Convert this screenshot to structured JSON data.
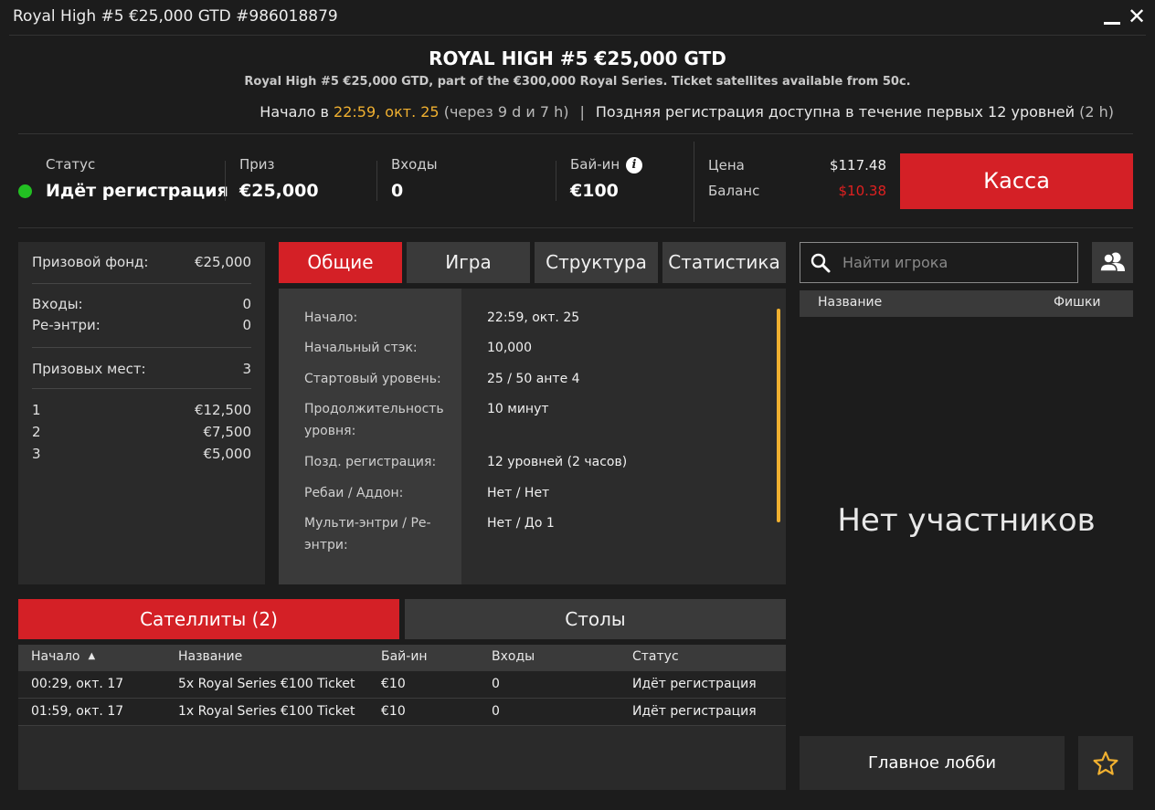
{
  "window": {
    "title": "Royal High #5 €25,000 GTD #986018879",
    "minimize_label": "_",
    "close_label": "✕"
  },
  "header": {
    "title": "ROYAL HIGH #5 €25,000 GTD",
    "subtitle": "Royal High #5 €25,000 GTD, part of the €300,000 Royal Series. Ticket satellites available from 50c.",
    "start_prefix": "Начало в ",
    "start_time": "22:59, окт. 25",
    "start_relative": " (через 9 d и 7 h)",
    "divider": "|",
    "late_reg": "Поздняя регистрация доступна в течение первых 12 уровней",
    "late_reg_duration": " (2 h)"
  },
  "stats": {
    "status_label": "Статус",
    "status_value": "Идёт регистрация",
    "status_color": "#22c022",
    "prize_label": "Приз",
    "prize_value": "€25,000",
    "entries_label": "Входы",
    "entries_value": "0",
    "buyin_label": "Бай-ин",
    "buyin_value": "€100",
    "info_icon": "i",
    "price_label": "Цена",
    "price_value": "$117.48",
    "balance_label": "Баланс",
    "balance_value": "$10.38",
    "balance_color": "#e02020",
    "cashier_label": "Касса"
  },
  "prize_panel": {
    "prize_pool_label": "Призовой фонд:",
    "prize_pool_value": "€25,000",
    "entries_label": "Входы:",
    "entries_value": "0",
    "reentries_label": "Ре-энтри:",
    "reentries_value": "0",
    "places_label": "Призовых мест:",
    "places_value": "3",
    "payouts": [
      {
        "place": "1",
        "amount": "€12,500"
      },
      {
        "place": "2",
        "amount": "€7,500"
      },
      {
        "place": "3",
        "amount": "€5,000"
      }
    ]
  },
  "tabs": [
    "Общие",
    "Игра",
    "Структура",
    "Статистика"
  ],
  "info": [
    {
      "label": "Начало:",
      "value": "22:59, окт. 25"
    },
    {
      "label": "Начальный стэк:",
      "value": "10,000"
    },
    {
      "label": "Стартовый уровень:",
      "value": "25 / 50 анте 4"
    },
    {
      "label": "Продолжительность уровня:",
      "value": "10 минут"
    },
    {
      "label": "Позд. регистрация:",
      "value": "12 уровней (2 часов)"
    },
    {
      "label": "Ребаи / Аддон:",
      "value": "Нет / Нет"
    },
    {
      "label": "Мульти-энтри / Ре-энтри:",
      "value": "Нет / До 1"
    }
  ],
  "bottom_tabs": [
    "Сателлиты (2)",
    "Столы"
  ],
  "satellites": {
    "columns": [
      "Начало",
      "Название",
      "Бай-ин",
      "Входы",
      "Статус"
    ],
    "sort_icon": "▲",
    "rows": [
      [
        "00:29, окт. 17",
        "5x Royal Series €100 Ticket",
        "€10",
        "0",
        "Идёт регистрация"
      ],
      [
        "01:59, окт. 17",
        "1x Royal Series €100 Ticket",
        "€10",
        "0",
        "Идёт регистрация"
      ]
    ]
  },
  "players": {
    "search_placeholder": "Найти игрока",
    "col_name": "Название",
    "col_chips": "Фишки",
    "empty_text": "Нет участников"
  },
  "footer": {
    "lobby_label": "Главное лобби"
  },
  "colors": {
    "accent_red": "#d42026",
    "accent_gold": "#f0b030"
  }
}
